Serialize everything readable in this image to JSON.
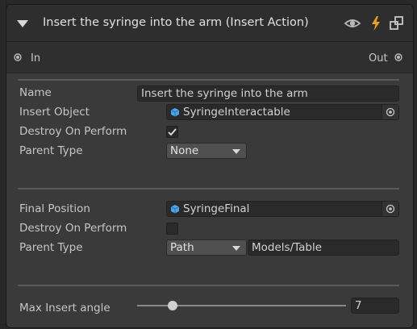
{
  "node": {
    "title": "Insert the syringe into the arm (Insert Action)",
    "header_icons": [
      "eye-icon",
      "lightning-icon",
      "node-settings-icon"
    ],
    "accent_colors": {
      "lightning": "#f0a020",
      "header_bg": "#2e2e2e",
      "body_bg": "#3a3a3a"
    }
  },
  "ports": {
    "in_label": "In",
    "out_label": "Out"
  },
  "fields": {
    "name_label": "Name",
    "name_value": "Insert the syringe into the arm",
    "insert_object_label": "Insert Object",
    "insert_object_value": "SyringeInteractable",
    "destroy_on_perform_label": "Destroy On Perform",
    "destroy_on_perform_checked": true,
    "parent_type_label": "Parent Type",
    "parent_type_value": "None"
  },
  "final": {
    "final_position_label": "Final Position",
    "final_position_value": "SyringeFinal",
    "destroy_on_perform_label": "Destroy On Perform",
    "destroy_on_perform_checked": false,
    "parent_type_label": "Parent Type",
    "parent_type_value": "Path",
    "path_value": "Models/Table"
  },
  "slider": {
    "label": "Max Insert angle",
    "value": "7",
    "fraction": 0.17
  }
}
